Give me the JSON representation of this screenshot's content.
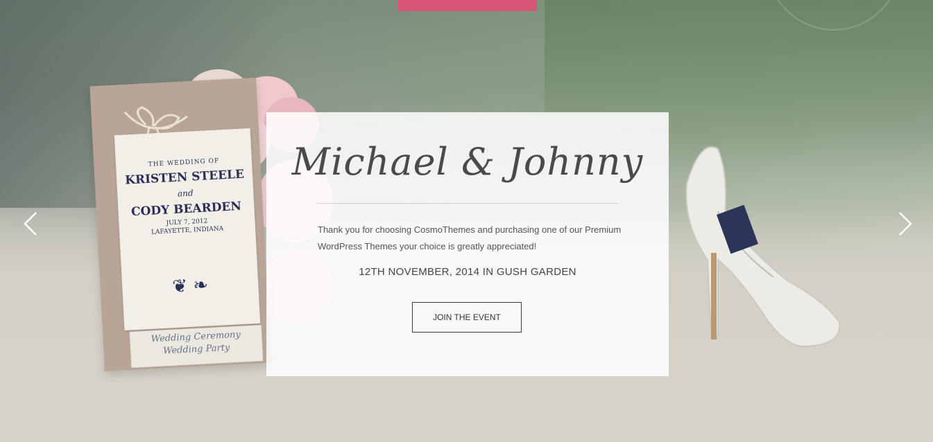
{
  "hero": {
    "couple_names": "Michael & Johnny",
    "message": "Thank you for choosing CosmoThemes and purchasing one of our Premium WordPress Themes your choice is greatly appreciated!",
    "event_date": "12TH NOVEMBER, 2014 IN GUSH GARDEN",
    "cta_label": "JOIN THE EVENT"
  },
  "invitation_card": {
    "line1": "THE WEDDING OF",
    "line2": "KRISTEN STEELE",
    "line3": "and",
    "line4": "CODY BEARDEN",
    "line5": "JULY 7, 2012",
    "line6": "LAFAYETTE, INDIANA",
    "sub1": "Wedding Ceremony",
    "sub2": "Wedding Party"
  },
  "icons": {
    "prev": "chevron-left-icon",
    "next": "chevron-right-icon"
  },
  "colors": {
    "accent": "#d9567a",
    "panel_bg": "#ffffff",
    "text_dark": "#444444"
  }
}
